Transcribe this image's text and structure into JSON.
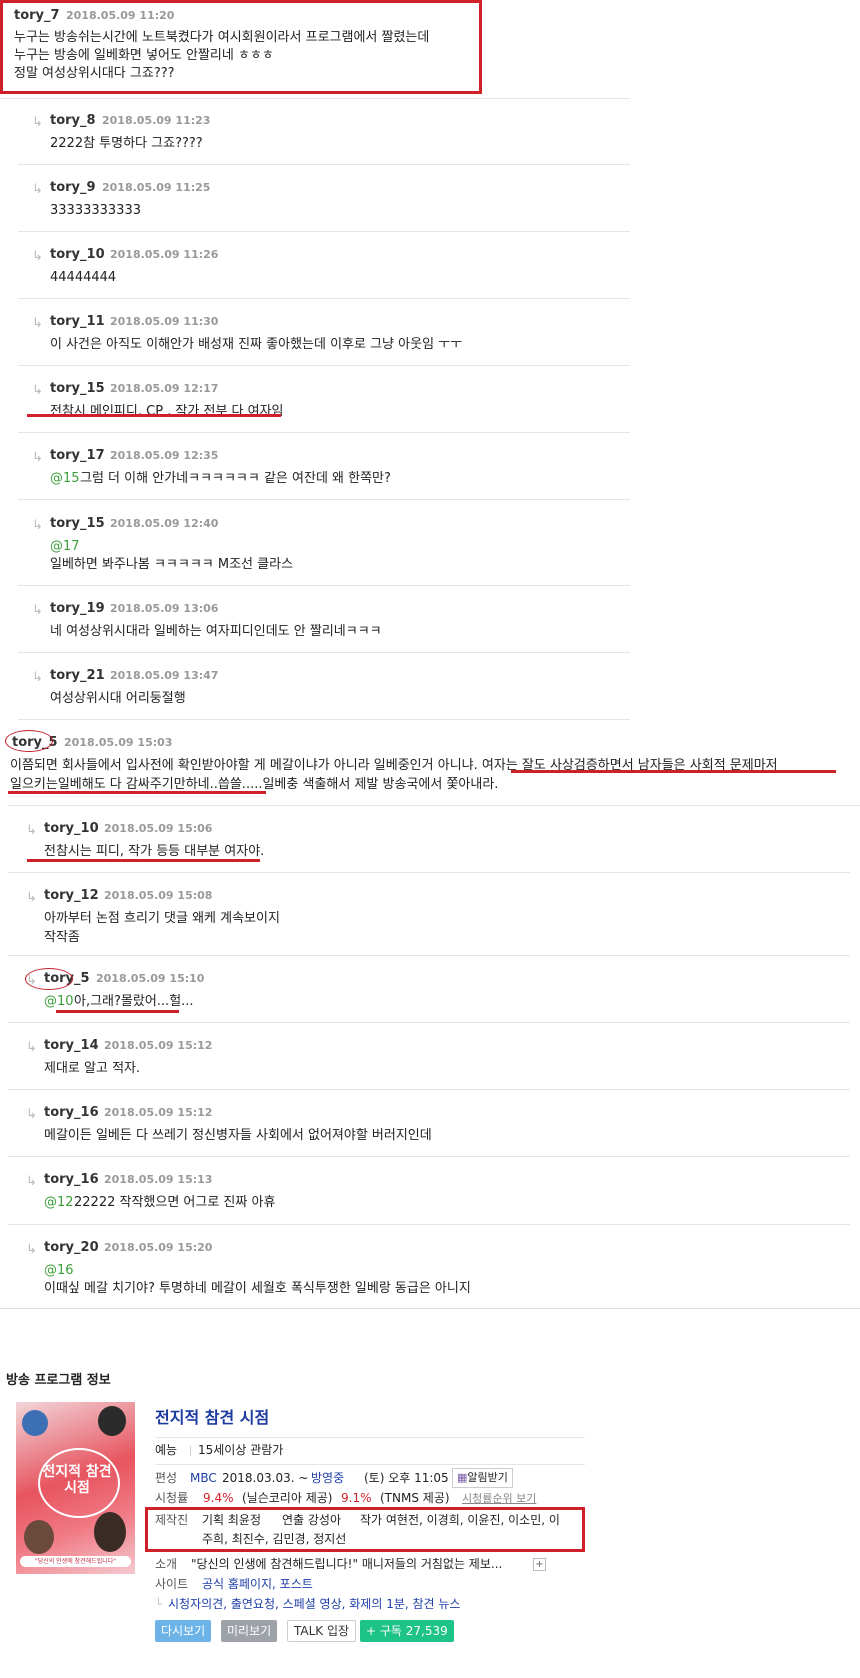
{
  "comments": [
    {
      "id": "c1",
      "name": "tory_7",
      "date": "2018.05.09 11:20",
      "lines": [
        "누구는 방송쉬는시간에 노트북켰다가 여시회원이라서 프로그램에서 짤렸는데",
        "누구는 방송에 일베화면 넣어도 안짤리네 ㅎㅎㅎ",
        "정말 여성상위시대다 그죠???"
      ]
    },
    {
      "id": "c2",
      "name": "tory_8",
      "date": "2018.05.09 11:23",
      "lines": [
        "2222참 투명하다 그죠????"
      ]
    },
    {
      "id": "c3",
      "name": "tory_9",
      "date": "2018.05.09 11:25",
      "lines": [
        "33333333333"
      ]
    },
    {
      "id": "c4",
      "name": "tory_10",
      "date": "2018.05.09 11:26",
      "lines": [
        "44444444"
      ]
    },
    {
      "id": "c5",
      "name": "tory_11",
      "date": "2018.05.09 11:30",
      "lines": [
        "이 사건은 아직도 이해안가 배성재 진짜 좋아했는데 이후로 그냥 아웃임 ㅜㅜ"
      ]
    },
    {
      "id": "c6",
      "name": "tory_15",
      "date": "2018.05.09 12:17",
      "lines": [
        "전참시 메인피디, CP , 작가 전부 다 여자임"
      ]
    },
    {
      "id": "c7",
      "name": "tory_17",
      "date": "2018.05.09 12:35",
      "mention": "@15",
      "lines": [
        "그럼 더 이해 안가네ㅋㅋㅋㅋㅋㅋ 같은 여잔데 왜 한쪽만?"
      ]
    },
    {
      "id": "c8",
      "name": "tory_15",
      "date": "2018.05.09 12:40",
      "mention": "@17",
      "lines": [
        "일베하면 봐주나봄 ㅋㅋㅋㅋㅋ M조선 클라스"
      ]
    },
    {
      "id": "c9",
      "name": "tory_19",
      "date": "2018.05.09 13:06",
      "lines": [
        "네 여성상위시대라 일베하는 여자피디인데도 안 짤리네ㅋㅋㅋ"
      ]
    },
    {
      "id": "c10",
      "name": "tory_21",
      "date": "2018.05.09 13:47",
      "lines": [
        "여성상위시대 어리둥절행"
      ]
    },
    {
      "id": "c11",
      "name": "tory_5",
      "date": "2018.05.09 15:03",
      "lines": [
        "이쯤되면 회사들에서 입사전에 확인받아야할 게 메갈이냐가 아니라 일베중인거 아니냐. 여자는 잘도 사상검증하면서 남자들은 사회적 문제마저",
        "일으키는일베해도 다 감싸주기만하네..씁쓸.....일베충 색출해서 제발 방송국에서 쫓아내라."
      ]
    },
    {
      "id": "c12",
      "name": "tory_10",
      "date": "2018.05.09 15:06",
      "lines": [
        "전참시는 피디, 작가 등등 대부분 여자야."
      ]
    },
    {
      "id": "c13",
      "name": "tory_12",
      "date": "2018.05.09 15:08",
      "lines": [
        "아까부터 논점 흐리기 댓글 왜케 계속보이지",
        "작작좀"
      ]
    },
    {
      "id": "c14",
      "name": "tory_5",
      "date": "2018.05.09 15:10",
      "mention": "@10",
      "lines": [
        "아,그래?몰랐어...헐..."
      ]
    },
    {
      "id": "c15",
      "name": "tory_14",
      "date": "2018.05.09 15:12",
      "lines": [
        "제대로 알고 적자."
      ]
    },
    {
      "id": "c16",
      "name": "tory_16",
      "date": "2018.05.09 15:12",
      "lines": [
        "메갈이든 일베든 다 쓰레기 정신병자들 사회에서 없어져야할 버러지인데"
      ]
    },
    {
      "id": "c17",
      "name": "tory_16",
      "date": "2018.05.09 15:13",
      "mention": "@12",
      "lines": [
        "22222 작작했으면 어그로 진짜 아휴"
      ]
    },
    {
      "id": "c18",
      "name": "tory_20",
      "date": "2018.05.09 15:20",
      "mention": "@16",
      "lines": [
        "이때싶 메갈 치기야? 투명하네 메갈이 세월호 폭식투쟁한 일베랑 동급은 아니지"
      ]
    }
  ],
  "program": {
    "section_title": "방송 프로그램 정보",
    "title": "전지적 참견 시점",
    "genre": "예능",
    "rating_age": "15세이상 관람가",
    "schedule_label": "편성",
    "channel": "MBC",
    "start": "2018.03.03. ~",
    "status": "방영중",
    "time": "(토) 오후 11:05",
    "alarm": "알림받기",
    "ratings_label": "시청률",
    "rating1_value": "9.4%",
    "rating1_src": "(닐슨코리아 제공)",
    "rating2_value": "9.1%",
    "rating2_src": "(TNMS 제공)",
    "rating_rank": "시청률순위 보기",
    "staff_label": "제작진",
    "staff_plan": "기획 최윤정",
    "staff_direct": "연출 강성아",
    "staff_writer_1": "작가 여현전, 이경희, 이윤진, 이소민, 이",
    "staff_writer_2": "주희, 최진수, 김민경, 정지선",
    "intro_label": "소개",
    "intro": "\"당신의 인생에 참견해드립니다!\" 매니저들의 거침없는 제보...",
    "site_label": "사이트",
    "site_links": "공식 홈페이지, 포스트",
    "sub_links": "시청자의견, 출연요청, 스페셜 영상, 화제의 1분, 참견 뉴스",
    "btn_replay": "다시보기",
    "btn_preview": "미리보기",
    "btn_talk": "TALK 입장",
    "btn_subscribe": "+ 구독 27,539",
    "poster_text": "전지적 참견 시점",
    "poster_caption": "\"당신의 인생에 참견해드립니다\""
  }
}
